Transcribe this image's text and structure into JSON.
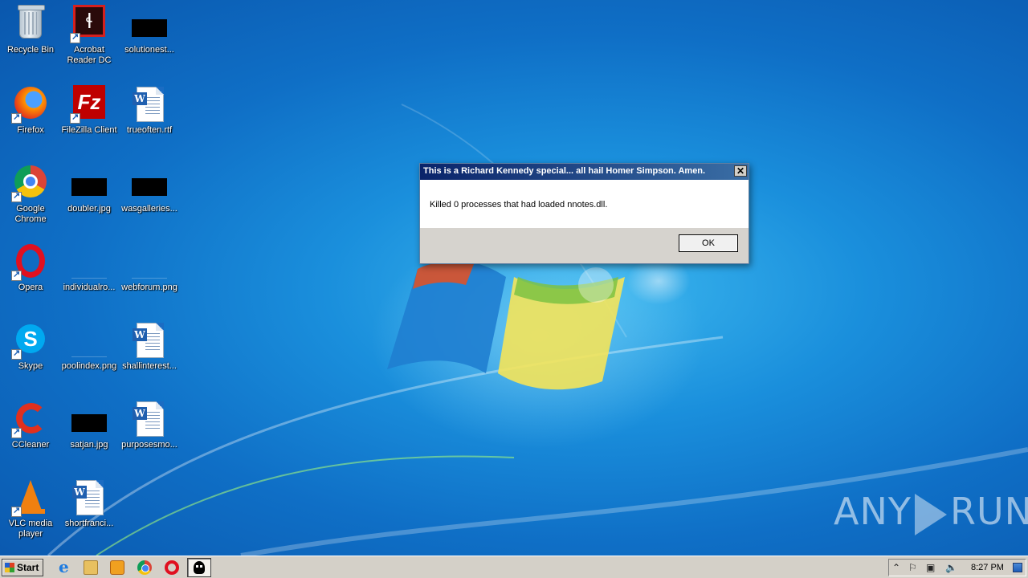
{
  "desktop": {
    "icons": [
      {
        "label": "Recycle Bin",
        "icon": "recycle-bin-icon"
      },
      {
        "label": "Acrobat Reader DC",
        "icon": "acrobat-icon"
      },
      {
        "label": "solutionest...",
        "icon": "redacted-thumbnail"
      },
      {
        "label": "Firefox",
        "icon": "firefox-icon"
      },
      {
        "label": "FileZilla Client",
        "icon": "filezilla-icon"
      },
      {
        "label": "trueoften.rtf",
        "icon": "word-doc-icon"
      },
      {
        "label": "Google Chrome",
        "icon": "chrome-icon"
      },
      {
        "label": "doubler.jpg",
        "icon": "redacted-thumbnail"
      },
      {
        "label": "wasgalleries...",
        "icon": "redacted-thumbnail"
      },
      {
        "label": "Opera",
        "icon": "opera-icon"
      },
      {
        "label": "individualro...",
        "icon": "blank-thumbnail"
      },
      {
        "label": "webforum.png",
        "icon": "blank-thumbnail"
      },
      {
        "label": "Skype",
        "icon": "skype-icon"
      },
      {
        "label": "poolindex.png",
        "icon": "blank-thumbnail"
      },
      {
        "label": "shallinterest...",
        "icon": "word-doc-icon"
      },
      {
        "label": "CCleaner",
        "icon": "ccleaner-icon"
      },
      {
        "label": "satjan.jpg",
        "icon": "redacted-thumbnail"
      },
      {
        "label": "purposesmo...",
        "icon": "word-doc-icon"
      },
      {
        "label": "VLC media player",
        "icon": "vlc-icon"
      },
      {
        "label": "shortfranci...",
        "icon": "word-doc-icon"
      }
    ]
  },
  "dialog": {
    "title": "This is a Richard Kennedy special... all hail Homer Simpson. Amen.",
    "message": "Killed 0 processes that had loaded nnotes.dll.",
    "ok_label": "OK",
    "close_glyph": "✕"
  },
  "watermark": {
    "left": "ANY",
    "right": "RUN"
  },
  "taskbar": {
    "start_label": "Start",
    "clock": "8:27 PM"
  },
  "colors": {
    "titlebar": "#0a246a",
    "desktop": "#1a8fdc"
  }
}
